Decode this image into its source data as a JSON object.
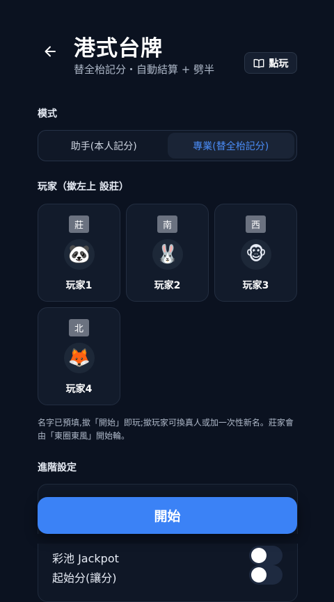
{
  "header": {
    "title": "港式台牌",
    "subtitle": "替全枱記分・自動結算 + 劈半",
    "howto_label": "點玩"
  },
  "mode": {
    "section_label": "模式",
    "options": [
      {
        "label": "助手(本人記分)",
        "selected": false
      },
      {
        "label": "專業(替全枱記分)",
        "selected": true
      }
    ]
  },
  "players": {
    "section_label": "玩家（撳左上 設莊）",
    "items": [
      {
        "wind": "莊",
        "avatar": "🐼",
        "name": "玩家1"
      },
      {
        "wind": "南",
        "avatar": "🐰",
        "name": "玩家2"
      },
      {
        "wind": "西",
        "avatar": "🐵",
        "name": "玩家3"
      },
      {
        "wind": "北",
        "avatar": "🦊",
        "name": "玩家4"
      }
    ],
    "note": "名字已預填,撳「開始」即玩;撳玩家可換真人或加一次性新名。莊家會由「東圈東風」開始輪。"
  },
  "advanced": {
    "section_label": "進階設定",
    "rows": [
      {
        "label": "彩池 Jackpot",
        "on": false
      },
      {
        "label": "起始分(讓分)",
        "on": false
      }
    ]
  },
  "start_label": "開始",
  "colors": {
    "background": "#0b1220",
    "accent": "#3b82f6",
    "selected_text": "#4a8bf5"
  }
}
